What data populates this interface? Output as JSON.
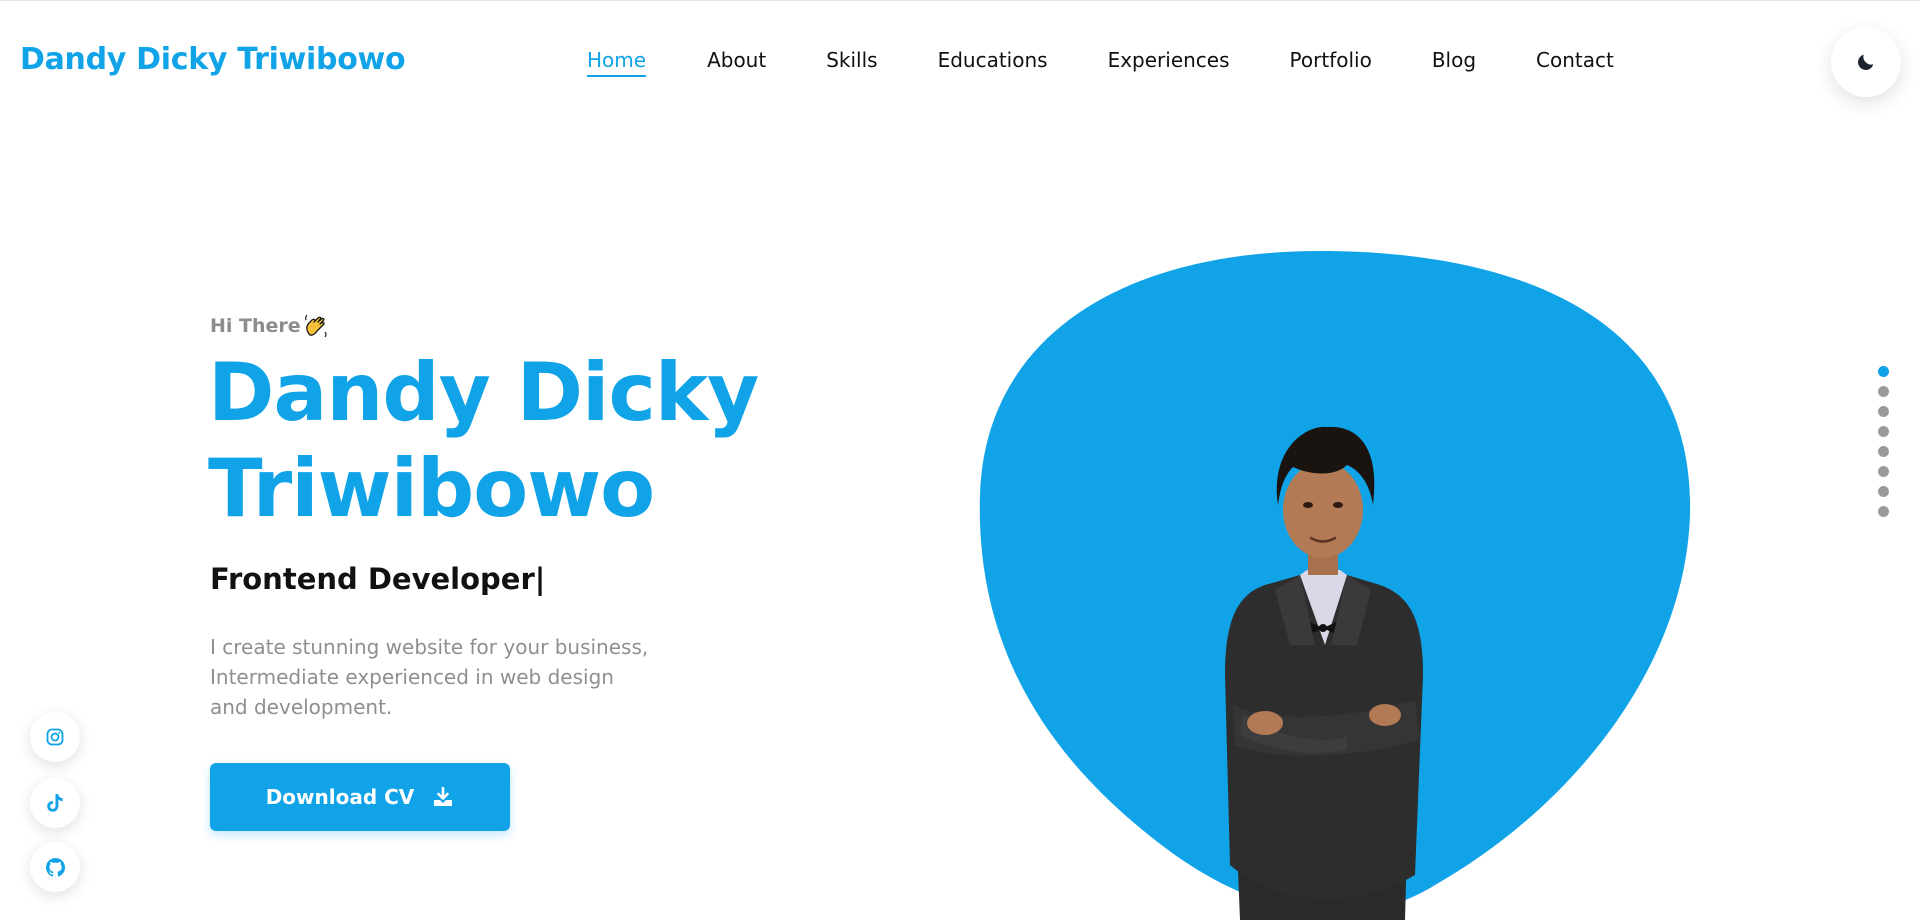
{
  "header": {
    "brand": "Dandy Dicky Triwibowo",
    "nav": [
      {
        "label": "Home",
        "active": true
      },
      {
        "label": "About"
      },
      {
        "label": "Skills"
      },
      {
        "label": "Educations"
      },
      {
        "label": "Experiences"
      },
      {
        "label": "Portfolio"
      },
      {
        "label": "Blog"
      },
      {
        "label": "Contact"
      }
    ],
    "theme_icon": "moon-icon"
  },
  "hero": {
    "greeting": "Hi There",
    "greeting_icon": "waving-hand-icon",
    "name_line1": "Dandy Dicky",
    "name_line2": "Triwibowo",
    "role": "Frontend Developer|",
    "description_line1": "I create stunning website for your business,",
    "description_line2": "Intermediate experienced in web design",
    "description_line3": "and development.",
    "cv_button": "Download CV",
    "cv_icon": "download-icon"
  },
  "social": [
    {
      "icon": "instagram-icon"
    },
    {
      "icon": "tiktok-icon"
    },
    {
      "icon": "github-icon"
    }
  ],
  "section_dots": {
    "count": 8,
    "active_index": 0
  },
  "colors": {
    "accent": "#10a3e8",
    "text": "#111111",
    "muted": "#8f8f8f",
    "dot": "#9a9a9a"
  }
}
